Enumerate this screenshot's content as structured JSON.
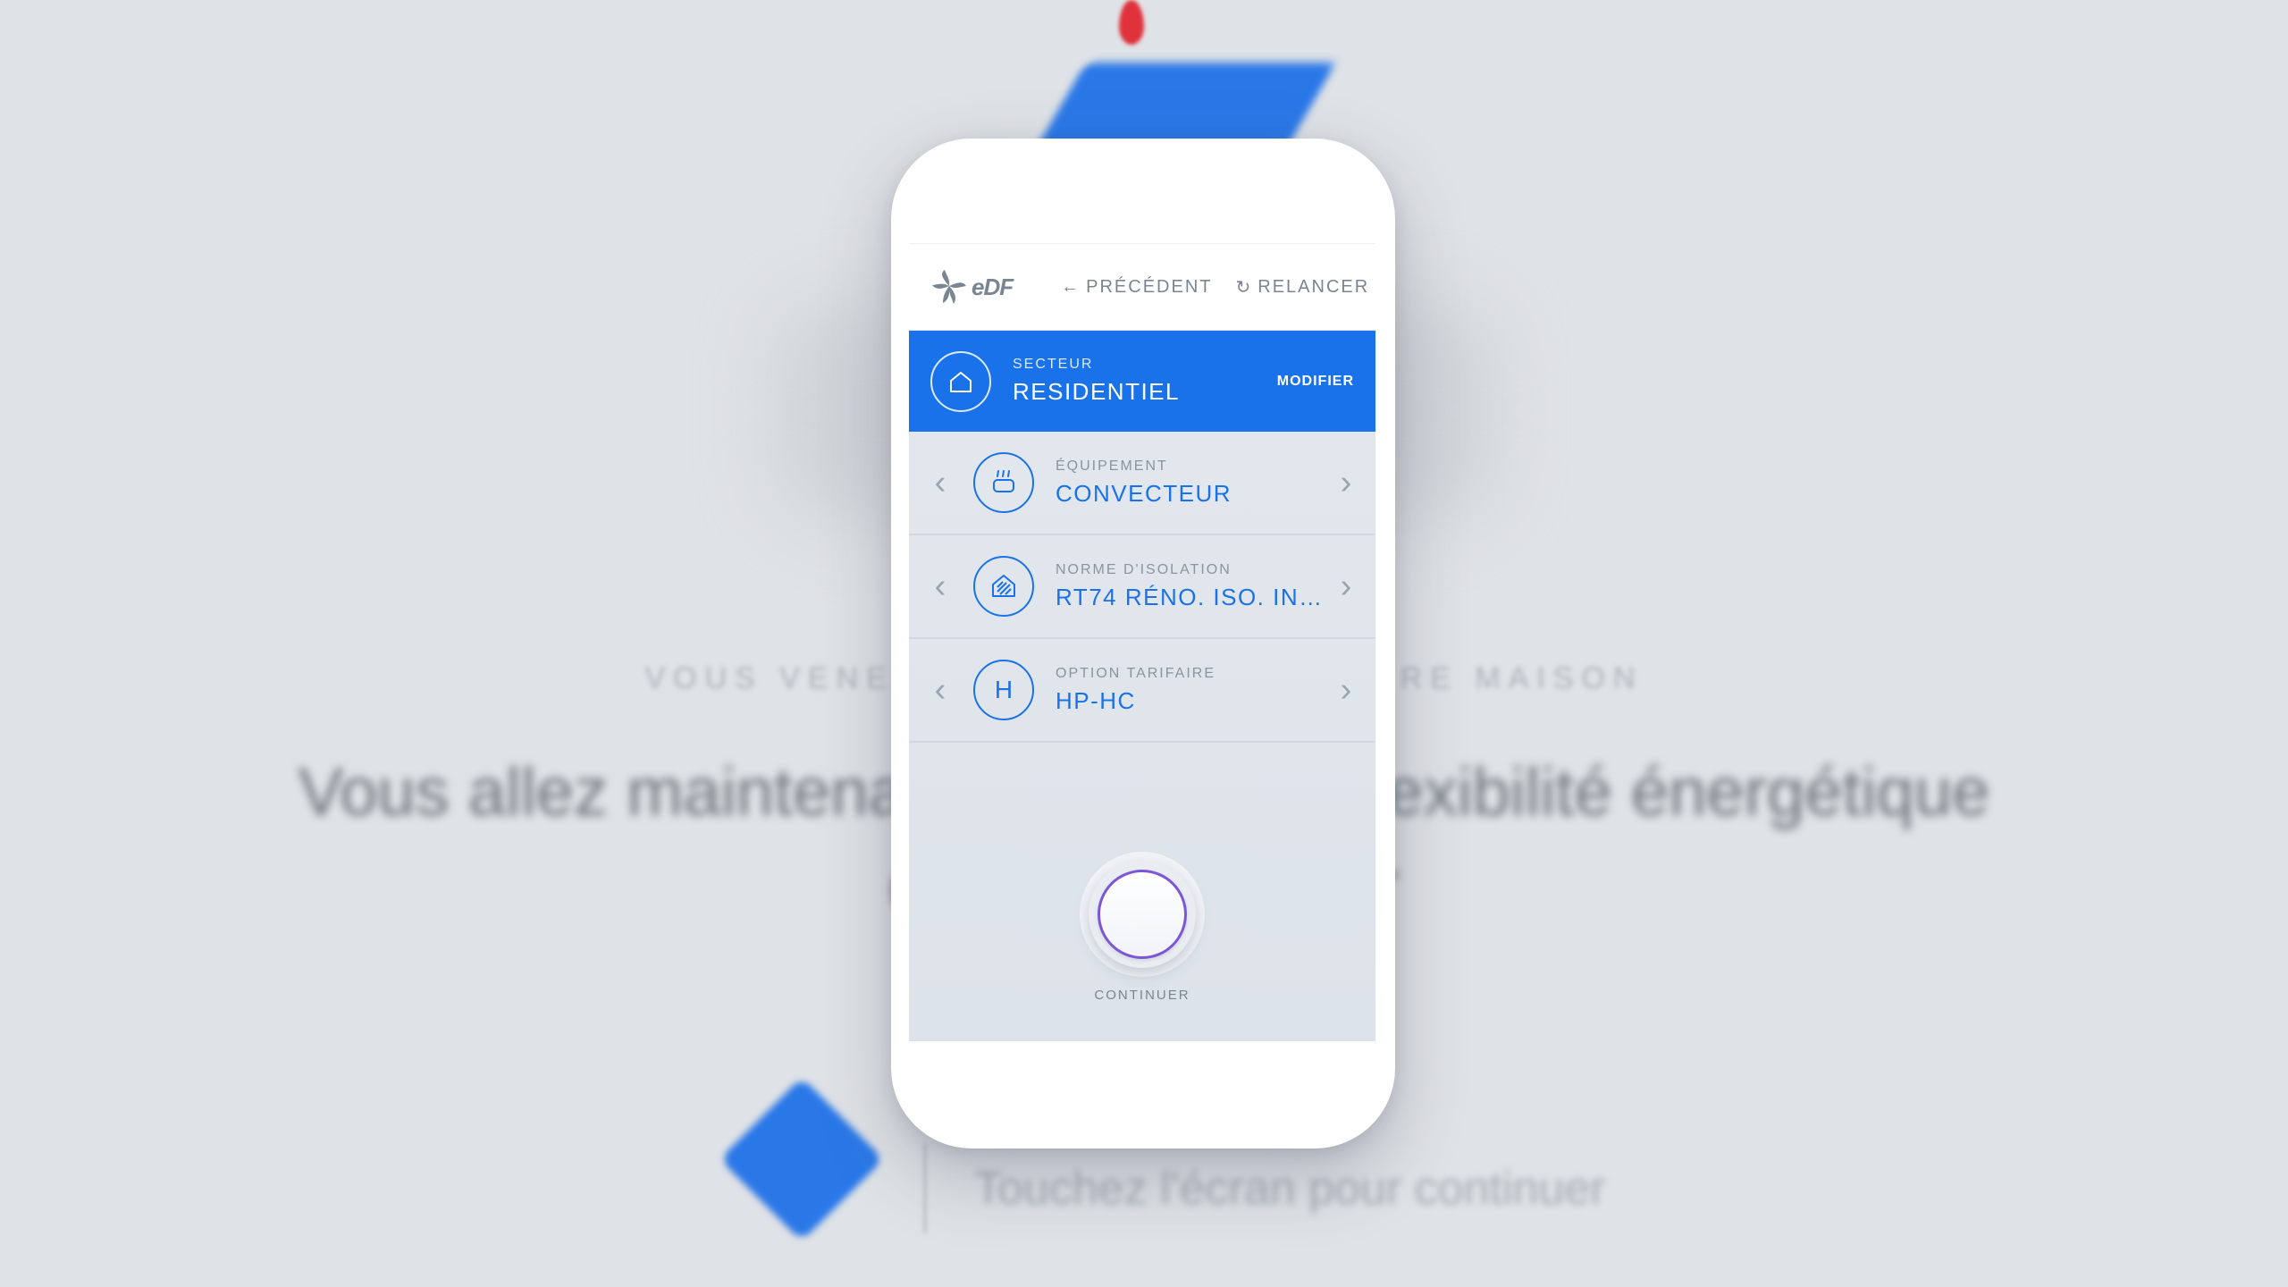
{
  "background": {
    "subtitle": "VOUS VENEZ DE CONFIGURER VOTRE MAISON",
    "headline_line1": "Vous allez maintenant découvrir la flexibilité énergétique",
    "headline_line2": "de votre intérieur",
    "cta_text": "Touchez l'écran pour continuer"
  },
  "header": {
    "logo_text": "eDF",
    "previous_label": "PRÉCÉDENT",
    "restart_label": "RELANCER"
  },
  "sector": {
    "label": "SECTEUR",
    "value": "RESIDENTIEL",
    "modify_label": "MODIFIER"
  },
  "rows": [
    {
      "label": "ÉQUIPEMENT",
      "value": "CONVECTEUR",
      "icon": "radiator-icon"
    },
    {
      "label": "NORME D'ISOLATION",
      "value": "RT74 RÉNO. ISO. INT...",
      "icon": "insulation-house-icon"
    },
    {
      "label": "OPTION TARIFAIRE",
      "value": "HP-HC",
      "icon": "h-icon",
      "icon_text": "H"
    }
  ],
  "continue": {
    "label": "CONTINUER"
  },
  "colors": {
    "brand_blue": "#1a72ea",
    "accent_purple": "#7b57d6",
    "text_gray": "#7a8592"
  }
}
